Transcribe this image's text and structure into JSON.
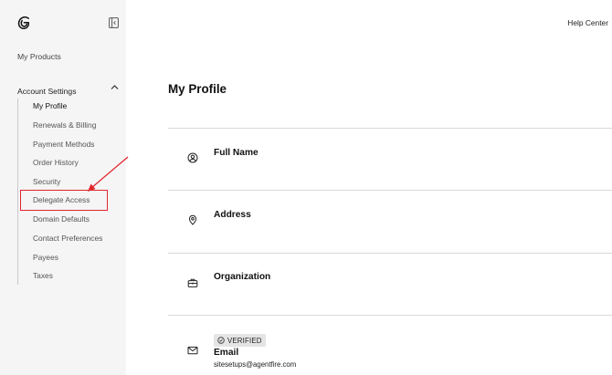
{
  "sidebar": {
    "my_products": "My Products",
    "account_settings": "Account Settings",
    "items": [
      {
        "label": "My Profile",
        "active": true
      },
      {
        "label": "Renewals & Billing"
      },
      {
        "label": "Payment Methods"
      },
      {
        "label": "Order History"
      },
      {
        "label": "Security"
      },
      {
        "label": "Delegate Access",
        "highlighted": true
      },
      {
        "label": "Domain Defaults"
      },
      {
        "label": "Contact Preferences"
      },
      {
        "label": "Payees"
      },
      {
        "label": "Taxes"
      }
    ]
  },
  "header": {
    "help_center": "Help Center"
  },
  "main": {
    "title": "My Profile",
    "sections": [
      {
        "title": "Full Name",
        "icon": "user-circle-icon"
      },
      {
        "title": "Address",
        "icon": "location-pin-icon"
      },
      {
        "title": "Organization",
        "icon": "briefcase-icon"
      },
      {
        "title": "Email",
        "icon": "envelope-icon",
        "badge": "VERIFIED",
        "value": "sitesetups@agentfire.com"
      }
    ]
  },
  "annotation": {
    "color": "#e0262c"
  }
}
